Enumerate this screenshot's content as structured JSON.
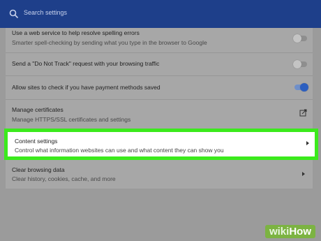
{
  "search": {
    "placeholder": "Search settings"
  },
  "settings": [
    {
      "title": "Use a web service to help resolve spelling errors",
      "desc": "Smarter spell-checking by sending what you type in the browser to Google",
      "control": "toggle",
      "enabled": false
    },
    {
      "title": "Send a \"Do Not Track\" request with your browsing traffic",
      "control": "toggle",
      "enabled": false
    },
    {
      "title": "Allow sites to check if you have payment methods saved",
      "control": "toggle",
      "enabled": true
    },
    {
      "title": "Manage certificates",
      "desc": "Manage HTTPS/SSL certificates and settings",
      "control": "external-link-icon"
    },
    {
      "title": "Content settings",
      "desc": "Control what information websites can use and what content they can show you",
      "control": "chevron-right-icon",
      "highlighted": true
    },
    {
      "title": "Clear browsing data",
      "desc": "Clear history, cookies, cache, and more",
      "control": "chevron-right-icon"
    }
  ],
  "watermark": {
    "part1": "wiki",
    "part2": "How"
  },
  "colors": {
    "highlight": "#3bea1c",
    "toggle_on": "#2c5fc0",
    "header": "#1e3f8a"
  }
}
